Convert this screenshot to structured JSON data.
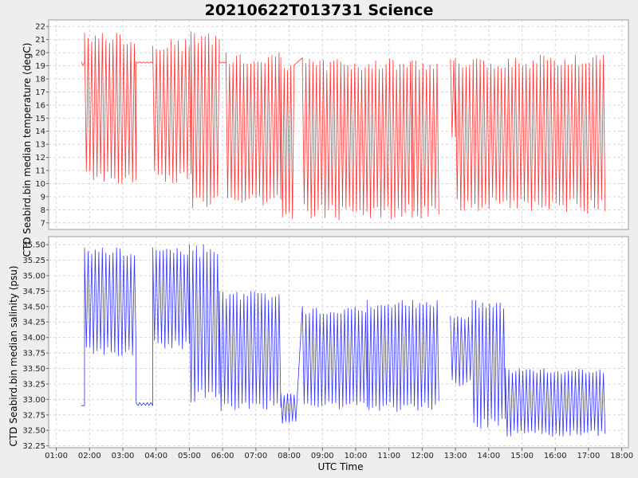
{
  "title": "20210622T013731 Science",
  "xlabel": "UTC Time",
  "colors": {
    "temperature": "#ff3333",
    "salinity": "#3333ff",
    "background": "#eeeeee",
    "plot_bg": "#ffffff",
    "grid": "#d4d4d4"
  },
  "chart_data": [
    {
      "type": "line",
      "ylabel": "CTD Seabird.bin median temperature (degC)",
      "ylim": [
        6.5,
        22.5
      ],
      "yticks": [
        "7",
        "8",
        "9",
        "10",
        "11",
        "12",
        "13",
        "14",
        "15",
        "16",
        "17",
        "18",
        "19",
        "20",
        "21",
        "22"
      ],
      "xticks": [
        "01:00",
        "02:00",
        "03:00",
        "04:00",
        "05:00",
        "06:00",
        "07:00",
        "08:00",
        "09:00",
        "10:00",
        "11:00",
        "12:00",
        "13:00",
        "14:00",
        "15:00",
        "16:00",
        "17:00",
        "18:00"
      ],
      "xlim_hours": [
        0.77,
        18.2
      ],
      "grid": true,
      "series": [
        {
          "segments": [
            {
              "start": 1.75,
              "end": 1.85,
              "min": 19.0,
              "max": 19.3
            },
            {
              "start": 1.85,
              "end": 3.4,
              "min": 10.0,
              "max": 21.5
            },
            {
              "start": 3.4,
              "end": 3.9,
              "min": 19.2,
              "max": 19.3
            },
            {
              "start": 3.9,
              "end": 4.45,
              "min": 10.0,
              "max": 20.5
            },
            {
              "start": 4.45,
              "end": 5.05,
              "min": 9.8,
              "max": 21.0
            },
            {
              "start": 5.05,
              "end": 5.9,
              "min": 8.0,
              "max": 21.6
            },
            {
              "start": 5.9,
              "end": 6.1,
              "min": 19.2,
              "max": 19.3
            },
            {
              "start": 6.1,
              "end": 7.75,
              "min": 8.0,
              "max": 20.0
            },
            {
              "start": 7.75,
              "end": 8.15,
              "min": 7.2,
              "max": 19.6
            },
            {
              "start": 8.4,
              "end": 11.7,
              "min": 7.2,
              "max": 19.6
            },
            {
              "start": 11.7,
              "end": 12.5,
              "min": 7.2,
              "max": 19.4
            },
            {
              "start": 12.85,
              "end": 13.0,
              "min": 13.5,
              "max": 19.5
            },
            {
              "start": 13.0,
              "end": 15.55,
              "min": 7.9,
              "max": 19.6
            },
            {
              "start": 15.55,
              "end": 17.5,
              "min": 7.7,
              "max": 19.8
            }
          ]
        }
      ]
    },
    {
      "type": "line",
      "ylabel": "CTD Seabird.bin median salinity (psu)",
      "ylim": [
        32.22,
        35.63
      ],
      "yticks": [
        "32.25",
        "32.50",
        "32.75",
        "33.00",
        "33.25",
        "33.50",
        "33.75",
        "34.00",
        "34.25",
        "34.50",
        "34.75",
        "35.00",
        "35.25",
        "35.50"
      ],
      "grid": true,
      "series": [
        {
          "segments": [
            {
              "start": 1.75,
              "end": 1.85,
              "min": 32.9,
              "max": 32.9
            },
            {
              "start": 1.85,
              "end": 3.4,
              "min": 33.7,
              "max": 35.45
            },
            {
              "start": 3.4,
              "end": 3.9,
              "min": 32.9,
              "max": 32.95
            },
            {
              "start": 3.9,
              "end": 5.0,
              "min": 33.8,
              "max": 35.45
            },
            {
              "start": 5.0,
              "end": 5.9,
              "min": 32.9,
              "max": 35.5
            },
            {
              "start": 5.9,
              "end": 7.75,
              "min": 32.8,
              "max": 34.75
            },
            {
              "start": 7.75,
              "end": 8.2,
              "min": 32.6,
              "max": 33.1
            },
            {
              "start": 8.4,
              "end": 10.35,
              "min": 32.8,
              "max": 34.5
            },
            {
              "start": 10.35,
              "end": 12.5,
              "min": 32.8,
              "max": 34.6
            },
            {
              "start": 12.85,
              "end": 13.5,
              "min": 33.2,
              "max": 34.35
            },
            {
              "start": 13.5,
              "end": 14.5,
              "min": 32.5,
              "max": 34.6
            },
            {
              "start": 14.5,
              "end": 17.5,
              "min": 32.4,
              "max": 33.5
            }
          ]
        }
      ]
    }
  ]
}
